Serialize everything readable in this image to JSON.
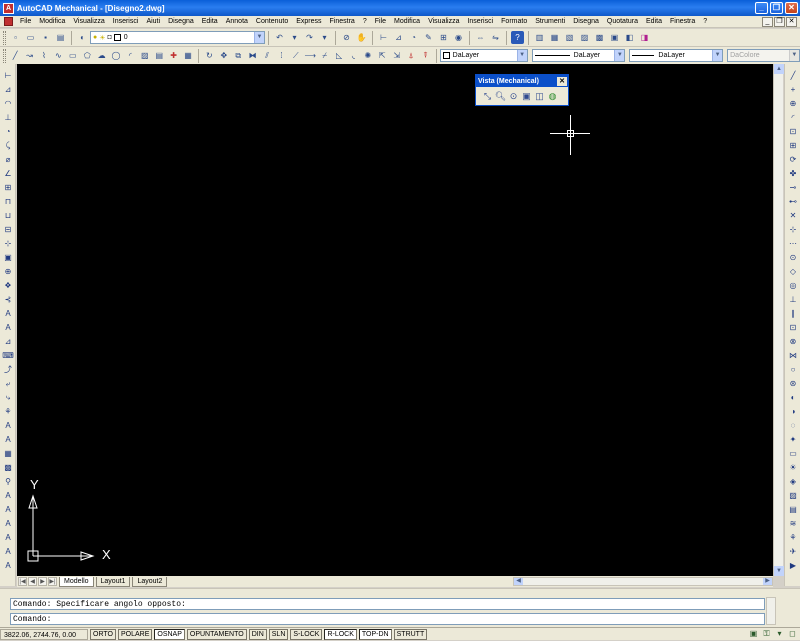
{
  "window": {
    "title": "AutoCAD Mechanical - [Disegno2.dwg]",
    "app_icon_letter": "A",
    "minimize": "_",
    "restore": "❐",
    "close": "✕"
  },
  "menubar": {
    "items": [
      "File",
      "Modifica",
      "Visualizza",
      "Inserisci",
      "Aiuti",
      "Disegna",
      "Edita",
      "Annota",
      "Contenuto",
      "Express",
      "Finestra",
      "?",
      "File",
      "Modifica",
      "Visualizza",
      "Inserisci",
      "Formato",
      "Strumenti",
      "Disegna",
      "Quotatura",
      "Edita",
      "Finestra",
      "?"
    ],
    "mdi_min": "_",
    "mdi_restore": "❐",
    "mdi_close": "✕"
  },
  "toolbar1": {
    "layer_combo_value": "0",
    "icons": [
      "new",
      "open",
      "save",
      "print",
      "preview",
      "plot",
      "cut",
      "copy",
      "paste",
      "matchprop",
      "undo",
      "redo",
      "pan",
      "zoom",
      "properties",
      "designcenter",
      "toolpalettes",
      "sheetset",
      "markup",
      "calc",
      "help"
    ]
  },
  "properties": {
    "color": "DaLayer",
    "linetype": "DaLayer",
    "lineweight": "DaLayer",
    "plotstyle": "DaColore"
  },
  "floating_toolbar": {
    "title": "Vista (Mechanical)",
    "close": "✕",
    "icons": [
      "zoom-window-icon",
      "zoom-realtime-icon",
      "zoom-previous-icon",
      "named-views-icon",
      "viewport-icon",
      "3d-orbit-icon"
    ]
  },
  "ucs": {
    "x_label": "X",
    "y_label": "Y"
  },
  "layout_tabs": [
    "Modello",
    "Layout1",
    "Layout2"
  ],
  "command": {
    "history": "Comando: Specificare angolo opposto:",
    "prompt": "Comando:"
  },
  "status": {
    "coords": "3822.06, 2744.76, 0.00",
    "buttons": [
      "ORTO",
      "POLARE",
      "OSNAP",
      "OPUNTAMENTO",
      "DIN",
      "SLN",
      "S-LOCK",
      "R-LOCK",
      "TOP-DN",
      "STRUTT"
    ],
    "on_buttons": [
      "OSNAP",
      "R-LOCK",
      "TOP-DN"
    ]
  },
  "colors": {
    "titlebar": "#0a5fd8",
    "canvas": "#000000",
    "chrome": "#ece9d8"
  }
}
